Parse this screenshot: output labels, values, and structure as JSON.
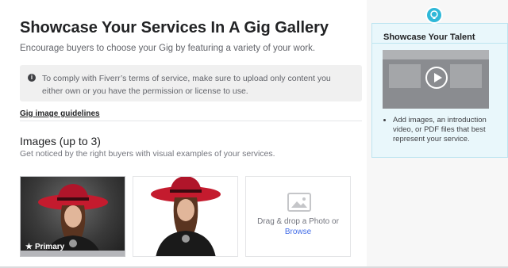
{
  "header": {
    "title": "Showcase Your Services In A Gig Gallery",
    "subtitle": "Encourage buyers to choose your Gig by featuring a variety of your work."
  },
  "notice": {
    "text": "To comply with Fiverr’s terms of service, make sure to upload only content you either own or you have the permission or license to use.",
    "icon": "info-icon"
  },
  "guidelines_link": "Gig image guidelines",
  "images_section": {
    "title": "Images (up to 3)",
    "subtitle": "Get noticed by the right buyers with visual examples of your services.",
    "slots": [
      {
        "primary_label": "Primary"
      },
      {},
      {
        "drop_text": "Drag & drop a Photo or",
        "browse_label": "Browse"
      }
    ]
  },
  "tip": {
    "title": "Showcase Your Talent",
    "bullet": "Add images, an introduction video, or PDF files that best represent your service.",
    "icon": "lightbulb-icon"
  },
  "colors": {
    "accent": "#446ee7",
    "tip_bg": "#e9f7fb",
    "bulb": "#2fb8d8"
  }
}
